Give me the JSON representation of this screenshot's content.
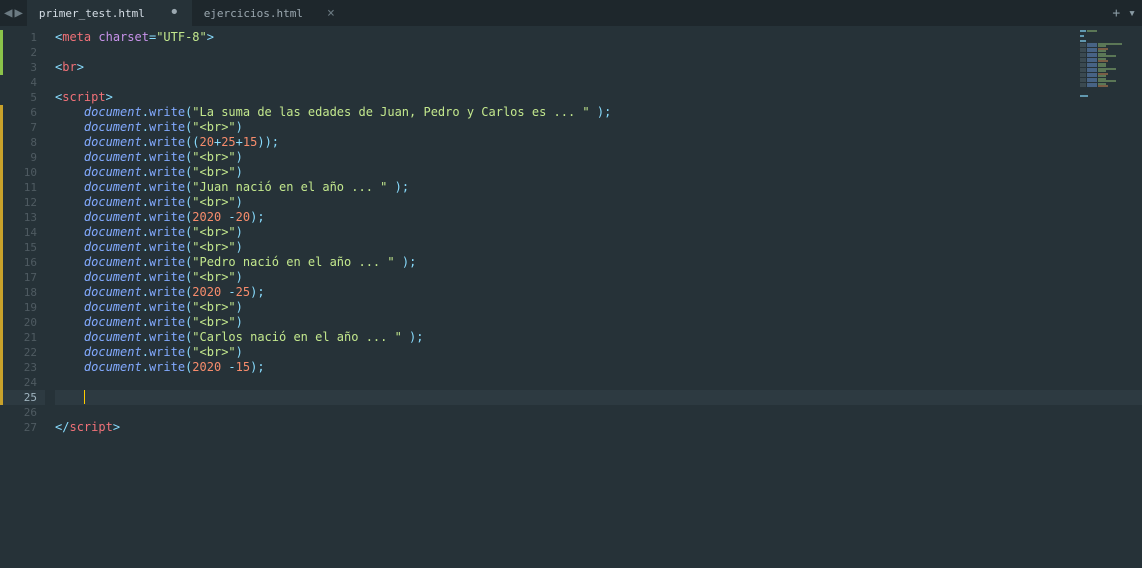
{
  "tabs": {
    "active": {
      "label": "primer_test.html",
      "modified": true
    },
    "inactive": {
      "label": "ejercicios.html"
    }
  },
  "gutter": {
    "lines": [
      "1",
      "2",
      "3",
      "4",
      "5",
      "6",
      "7",
      "8",
      "9",
      "10",
      "11",
      "12",
      "13",
      "14",
      "15",
      "16",
      "17",
      "18",
      "19",
      "20",
      "21",
      "22",
      "23",
      "24",
      "25",
      "26",
      "27"
    ],
    "currentLine": 25,
    "marks": {
      "1": "green",
      "2": "green",
      "3": "green",
      "6": "yellow",
      "7": "yellow",
      "8": "yellow",
      "9": "yellow",
      "10": "yellow",
      "11": "yellow",
      "12": "yellow",
      "13": "yellow",
      "14": "yellow",
      "15": "yellow",
      "16": "yellow",
      "17": "yellow",
      "18": "yellow",
      "19": "yellow",
      "20": "yellow",
      "21": "yellow",
      "22": "yellow",
      "23": "yellow",
      "24": "yellow",
      "25": "yellow"
    }
  },
  "code": {
    "l1": {
      "tag": "meta",
      "attr": "charset",
      "val": "\"UTF-8\""
    },
    "l3": {
      "tag": "br"
    },
    "l5": {
      "tag": "script"
    },
    "docwrite": {
      "obj": "document",
      "dot": ".",
      "method": "write"
    },
    "l6_str": "\"La suma de las edades de Juan, Pedro y Carlos es ... \"",
    "br_str": "\"<br>\"",
    "l8": {
      "a": "20",
      "op1": "+",
      "b": "25",
      "op2": "+",
      "c": "15"
    },
    "l11_str": "\"Juan nació en el año ... \"",
    "l13": {
      "a": "2020",
      "op": " -",
      "b": "20"
    },
    "l16_str": "\"Pedro nació en el año ... \"",
    "l18": {
      "a": "2020",
      "op": " -",
      "b": "25"
    },
    "l21_str": "\"Carlos nació en el año ... \"",
    "l23": {
      "a": "2020",
      "op": " -",
      "b": "15"
    },
    "l27": {
      "tag": "script"
    },
    "semi": ";",
    "lt": "<",
    "gt": ">",
    "slash": "/",
    "eq": "=",
    "lp": "(",
    "rp": ")",
    "lpp": "((",
    "rpp": "))",
    "sp": " ",
    "indent2": "    "
  }
}
